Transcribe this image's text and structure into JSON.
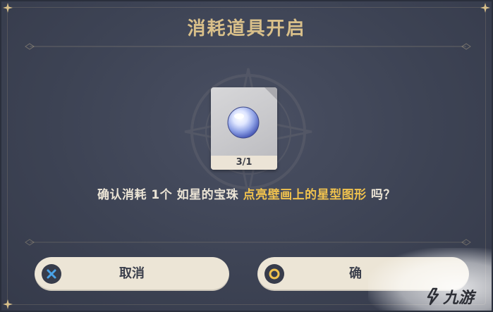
{
  "dialog": {
    "title": "消耗道具开启",
    "item": {
      "icon": "pearl-orb-icon",
      "count": "3/1"
    },
    "message": {
      "prefix": "确认消耗 1个 如星的宝珠",
      "highlight": "点亮壁画上的星型图形",
      "suffix": "吗？",
      "highlight_color": "#f0c24e"
    },
    "buttons": {
      "cancel": {
        "label": "取消",
        "icon": "cross-icon",
        "icon_color": "#4aa3e8"
      },
      "confirm": {
        "label": "确",
        "icon": "circle-icon",
        "icon_color": "#f0c24e"
      }
    }
  },
  "watermark": {
    "text": "九游",
    "logo": "jiuyou-logo-icon"
  },
  "colors": {
    "panel": "#3d4354",
    "title": "#d9c08a",
    "button": "#ece5d6",
    "text": "#ece5d6"
  }
}
